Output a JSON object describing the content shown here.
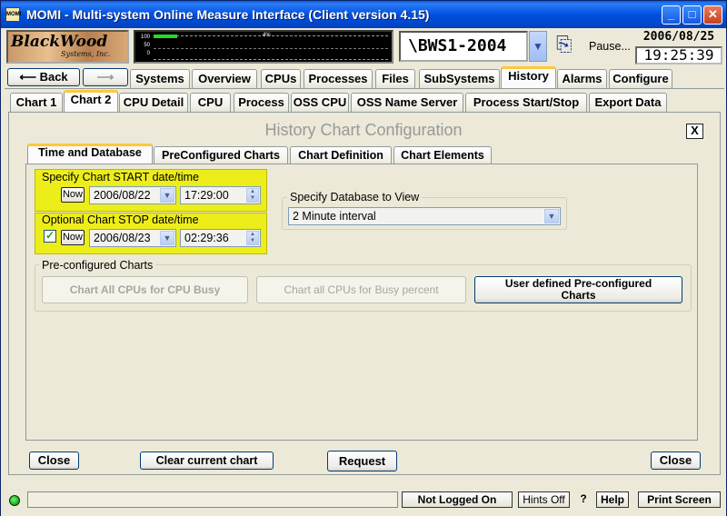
{
  "window": {
    "app_icon": "MOMI",
    "title": "MOMI - Multi-system Online Measure Interface (Client version 4.15)",
    "min_icon": "minimize-icon",
    "max_icon": "maximize-icon",
    "close_icon": "close-icon"
  },
  "brand": {
    "line1": "BlackWood",
    "line2": "Systems, Inc."
  },
  "meter": {
    "scale": [
      "100",
      "50",
      "0"
    ],
    "percent_label": "4%",
    "level": 0.04
  },
  "system": {
    "name": "\\BWS1-2004",
    "pause_label": "Pause...",
    "date": "2006/08/25",
    "time": "19:25:39"
  },
  "nav": {
    "back_label": "Back"
  },
  "main_tabs": [
    "Systems",
    "Overview",
    "CPUs",
    "Processes",
    "Files",
    "SubSystems",
    "History",
    "Alarms",
    "Configure"
  ],
  "main_tab_selected": "History",
  "sub_tabs": [
    "Chart 1",
    "Chart 2",
    "CPU Detail",
    "CPU",
    "Process",
    "OSS CPU",
    "OSS Name Server",
    "Process Start/Stop",
    "Export Data"
  ],
  "sub_tab_selected": "Chart 2",
  "config": {
    "title": "History Chart Configuration",
    "close_glyph": "X",
    "tabs": [
      "Time and Database",
      "PreConfigured Charts",
      "Chart Definition",
      "Chart Elements"
    ],
    "tab_selected": "Time and Database",
    "start": {
      "label": "Specify Chart START date/time",
      "now_label": "Now",
      "date": "2006/08/22",
      "time": "17:29:00"
    },
    "stop": {
      "label": "Optional Chart STOP date/time",
      "now_label": "Now",
      "checked": true,
      "date": "2006/08/23",
      "time": "02:29:36"
    },
    "database": {
      "label": "Specify Database to View",
      "value": "2 Minute interval"
    },
    "preconfig": {
      "group_label": "Pre-configured Charts",
      "btn1": "Chart All CPUs for CPU Busy",
      "btn2": "Chart all CPUs for Busy percent",
      "btn3_line1": "User defined Pre-configured",
      "btn3_line2": "Charts"
    },
    "bottom": {
      "close_left": "Close",
      "clear": "Clear current chart",
      "request": "Request",
      "close_right": "Close"
    }
  },
  "status": {
    "login": "Not Logged On",
    "hints": "Hints Off",
    "question": "?",
    "help": "Help",
    "print": "Print Screen"
  },
  "colors": {
    "highlight": "#eded1a",
    "tab_accent": "#ffc83c",
    "titlebar": "#0051e0"
  }
}
